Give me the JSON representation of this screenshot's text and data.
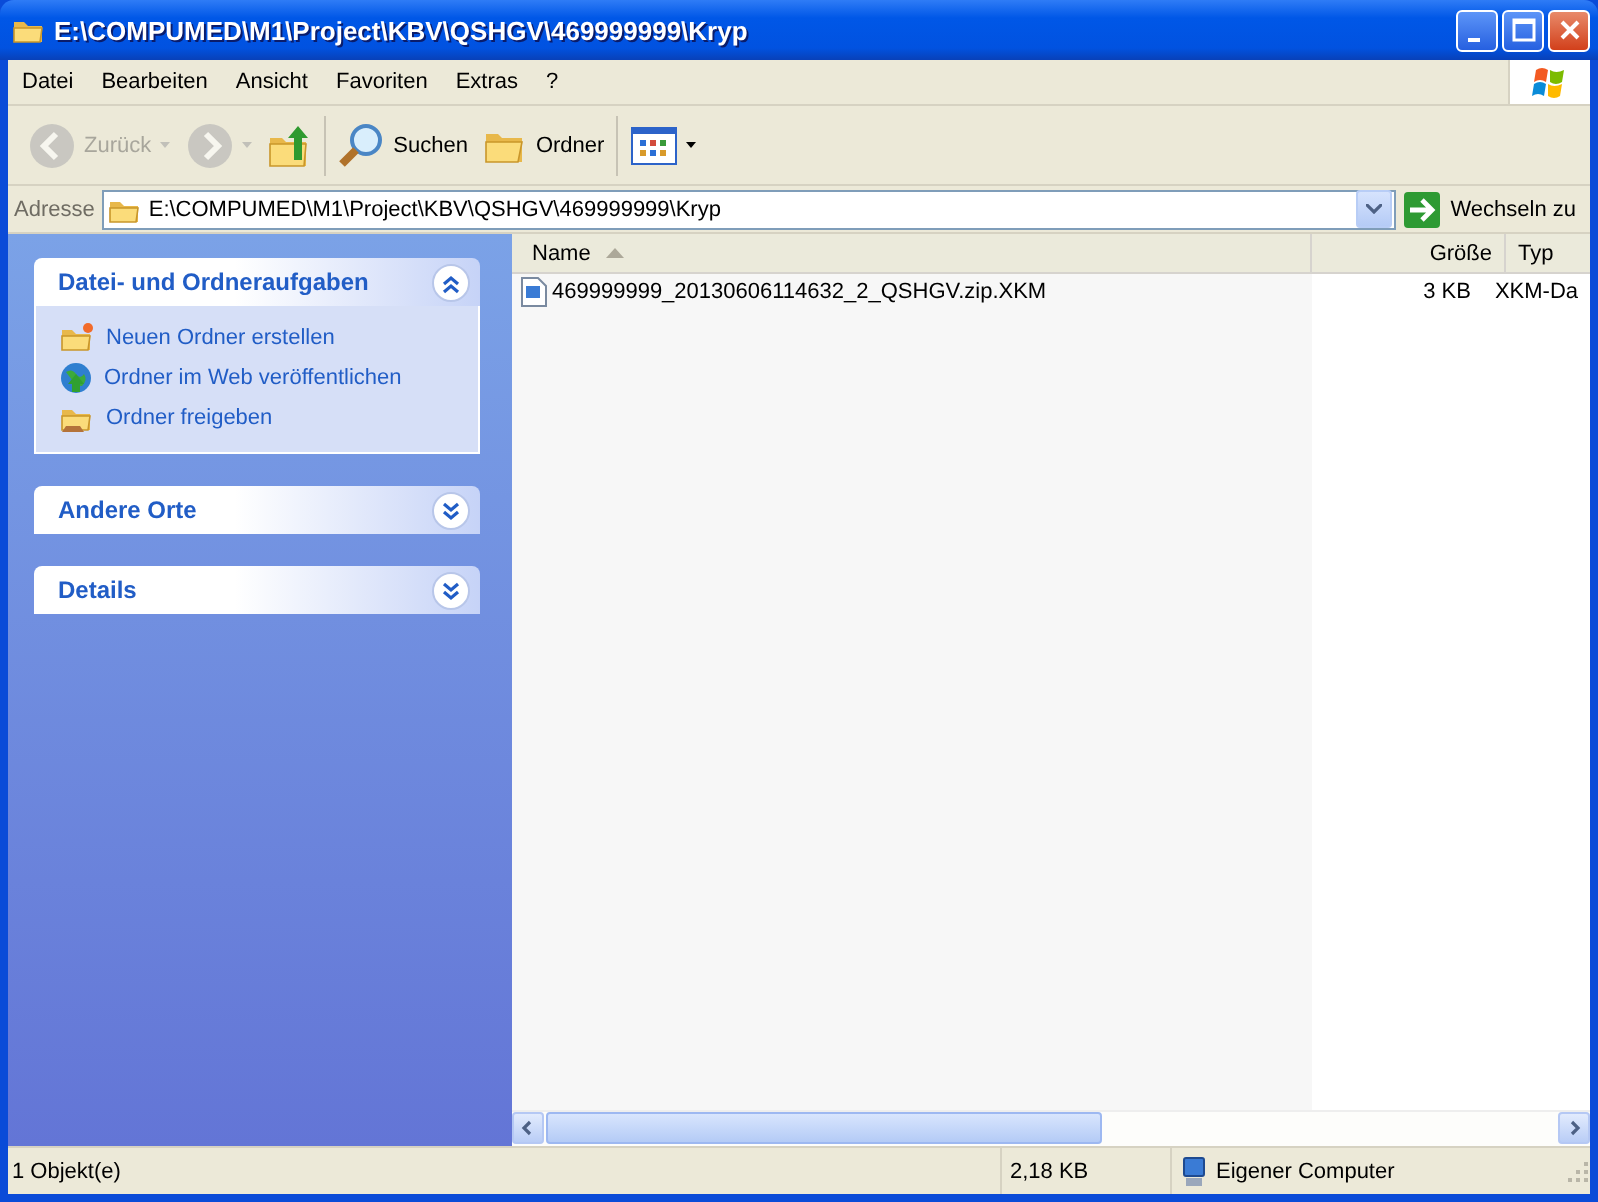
{
  "window": {
    "title": "E:\\COMPUMED\\M1\\Project\\KBV\\QSHGV\\469999999\\Kryp"
  },
  "menu": [
    "Datei",
    "Bearbeiten",
    "Ansicht",
    "Favoriten",
    "Extras",
    "?"
  ],
  "toolbar": [
    {
      "kind": "back",
      "label": "Zurück",
      "disabled": true
    },
    {
      "kind": "forward",
      "disabled": true
    },
    {
      "kind": "up",
      "disabled": false
    },
    {
      "kind": "search",
      "label": "Suchen",
      "disabled": false
    },
    {
      "kind": "folders",
      "label": "Ordner",
      "disabled": false
    },
    {
      "kind": "views",
      "disabled": false
    }
  ],
  "address": {
    "label": "Adresse",
    "value": "E:\\COMPUMED\\M1\\Project\\KBV\\QSHGV\\469999999\\Kryp",
    "go": "Wechseln zu"
  },
  "task_panes": [
    {
      "title": "Datei- und Ordneraufgaben",
      "expanded": true,
      "items": [
        {
          "kind": "new-folder",
          "label": "Neuen Ordner erstellen"
        },
        {
          "kind": "publish",
          "label": "Ordner im Web veröffentlichen"
        },
        {
          "kind": "share",
          "label": "Ordner freigeben"
        }
      ]
    },
    {
      "title": "Andere Orte",
      "expanded": false
    },
    {
      "title": "Details",
      "expanded": false
    }
  ],
  "file_list": {
    "columns": [
      {
        "label": "Name",
        "sorted": true
      },
      {
        "label": "Größe",
        "sorted": false
      },
      {
        "label": "Typ",
        "sorted": false
      }
    ],
    "rows": [
      {
        "name": "469999999_20130606114632_2_QSHGV.zip.XKM",
        "size": "3 KB",
        "type": "XKM-Da"
      }
    ]
  },
  "status_bar": [
    {
      "kind": "text",
      "label": "1 Objekt(e)"
    },
    {
      "kind": "text",
      "label": "2,18 KB"
    },
    {
      "kind": "computer",
      "label": "Eigener Computer"
    }
  ]
}
